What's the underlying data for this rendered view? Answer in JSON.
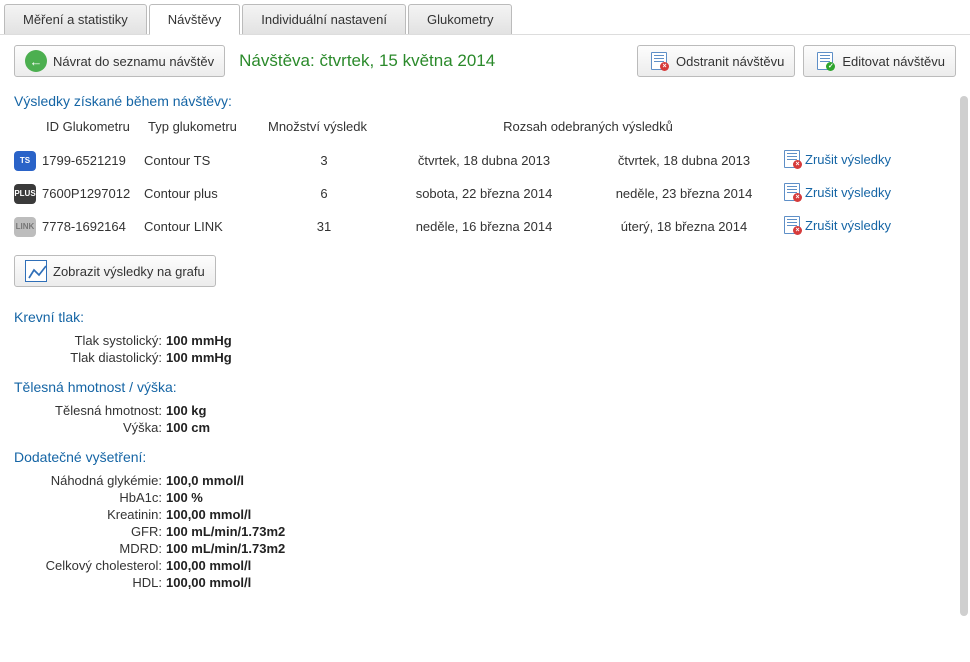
{
  "tabs": {
    "measurements": "Měření a statistiky",
    "visits": "Návštěvy",
    "individual": "Individuální nastavení",
    "meters": "Glukometry"
  },
  "toolbar": {
    "back": "Návrat do seznamu návštěv",
    "delete": "Odstranit návštěvu",
    "edit": "Editovat návštěvu"
  },
  "visitTitle": "Návštěva: čtvrtek, 15 května 2014",
  "sections": {
    "results": "Výsledky získané během návštěvy:",
    "bp": "Krevní tlak:",
    "weight": "Tělesná hmotnost / výška:",
    "extra": "Dodatečné vyšetření:"
  },
  "resultsHeaders": {
    "id": "ID Glukometru",
    "type": "Typ glukometru",
    "count": "Množství výsledk",
    "range": "Rozsah odebraných výsledků",
    "cancel": "Zrušit výsledky"
  },
  "resultsRows": [
    {
      "ic": "ts",
      "badge": "TS",
      "id": "1799-6521219",
      "type": "Contour TS",
      "count": "3",
      "from": "čtvrtek, 18 dubna 2013",
      "to": "čtvrtek, 18 dubna 2013"
    },
    {
      "ic": "plus",
      "badge": "PLUS",
      "id": "7600P1297012",
      "type": "Contour plus",
      "count": "6",
      "from": "sobota, 22 března 2014",
      "to": "neděle, 23 března 2014"
    },
    {
      "ic": "link",
      "badge": "LINK",
      "id": "7778-1692164",
      "type": "Contour LINK",
      "count": "31",
      "from": "neděle, 16 března 2014",
      "to": "úterý, 18 března 2014"
    }
  ],
  "chartBtn": "Zobrazit výsledky na grafu",
  "bp": {
    "sys_l": "Tlak systolický:",
    "sys_v": "100 mmHg",
    "dia_l": "Tlak diastolický:",
    "dia_v": "100 mmHg"
  },
  "wh": {
    "w_l": "Tělesná hmotnost:",
    "w_v": "100 kg",
    "h_l": "Výška:",
    "h_v": "100 cm"
  },
  "extra": {
    "g_l": "Náhodná glykémie:",
    "g_v": "100,0 mmol/l",
    "h_l": "HbA1c:",
    "h_v": "100 %",
    "k_l": "Kreatinin:",
    "k_v": "100,00 mmol/l",
    "gfr_l": "GFR:",
    "gfr_v": "100 mL/min/1.73m2",
    "mdrd_l": "MDRD:",
    "mdrd_v": "100 mL/min/1.73m2",
    "chol_l": "Celkový cholesterol:",
    "chol_v": "100,00 mmol/l",
    "hdl_l": "HDL:",
    "hdl_v": "100,00 mmol/l"
  }
}
